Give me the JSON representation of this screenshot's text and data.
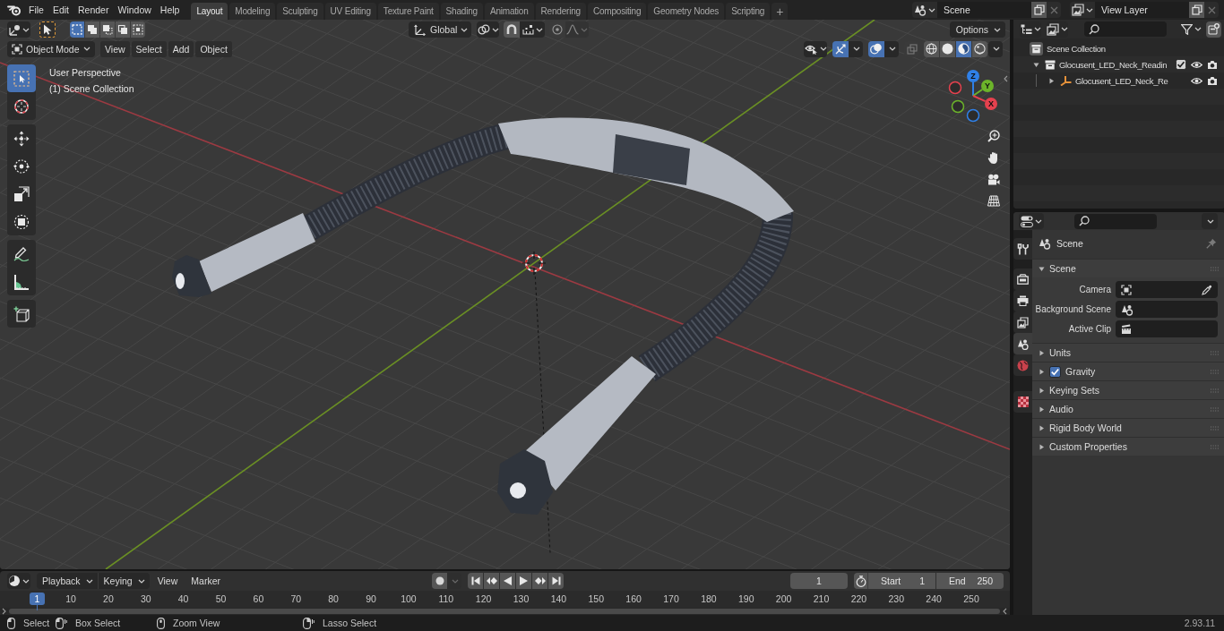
{
  "top_bar": {
    "menus": [
      "File",
      "Edit",
      "Render",
      "Window",
      "Help"
    ],
    "workspaces": [
      {
        "label": "Layout",
        "selected": true
      },
      {
        "label": "Modeling",
        "selected": false
      },
      {
        "label": "Sculpting",
        "selected": false
      },
      {
        "label": "UV Editing",
        "selected": false
      },
      {
        "label": "Texture Paint",
        "selected": false
      },
      {
        "label": "Shading",
        "selected": false
      },
      {
        "label": "Animation",
        "selected": false
      },
      {
        "label": "Rendering",
        "selected": false
      },
      {
        "label": "Compositing",
        "selected": false
      },
      {
        "label": "Geometry Nodes",
        "selected": false
      },
      {
        "label": "Scripting",
        "selected": false
      }
    ],
    "add_workspace": "+",
    "scene": "Scene",
    "view_layer": "View Layer"
  },
  "viewport": {
    "tool_header": {
      "select_modes": [
        {
          "selected": true
        },
        {
          "selected": false
        },
        {
          "selected": false
        },
        {
          "selected": false
        },
        {
          "selected": false
        }
      ],
      "orientation": "Global",
      "snap": {
        "on": false
      },
      "proportional": {
        "on": false
      },
      "options": "Options"
    },
    "header": {
      "mode": "Object Mode",
      "menus": [
        "View",
        "Select",
        "Add",
        "Object"
      ],
      "gizmos": {
        "on": true
      },
      "overlays": {
        "on": true
      },
      "xray": {
        "on": false
      },
      "shading": [
        {
          "selected": false
        },
        {
          "selected": false
        },
        {
          "selected": true
        },
        {
          "selected": false
        }
      ]
    },
    "tools": [
      {
        "selected": true
      },
      {
        "selected": false
      },
      {
        "selected": false
      },
      {
        "selected": false
      },
      {
        "selected": false
      },
      {
        "selected": false
      },
      {
        "selected": false
      },
      {
        "selected": false
      },
      {
        "selected": false
      }
    ],
    "info": [
      "User Perspective",
      "(1) Scene Collection"
    ],
    "navigation_gizmo": [
      {
        "label": "Z",
        "color": "#2f80e8"
      },
      {
        "label": "Y",
        "color": "#6cb42a"
      },
      {
        "label": "X",
        "color": "#e5414e"
      }
    ]
  },
  "outliner": {
    "tree": [
      {
        "kind": "scene_collection",
        "label": "Scene Collection",
        "children": [
          {
            "kind": "collection",
            "label": "Glocusent_LED_Neck_Readin",
            "expanded": true,
            "checked": true,
            "children": [
              {
                "kind": "object",
                "label": "Glocusent_LED_Neck_Re",
                "expanded": false
              }
            ]
          }
        ]
      }
    ]
  },
  "properties": {
    "tabs": [
      {
        "selected": false
      },
      {
        "selected": false
      },
      {
        "selected": false
      },
      {
        "selected": false
      },
      {
        "selected": true
      },
      {
        "selected": false
      },
      {
        "selected": false
      }
    ],
    "context": "Scene",
    "panels": [
      {
        "title": "Scene",
        "kind": "plain",
        "expanded": true,
        "fields": [
          {
            "label": "Camera",
            "kind": "object"
          },
          {
            "label": "Background Scene",
            "kind": "scene"
          },
          {
            "label": "Active Clip",
            "kind": "clip"
          }
        ]
      },
      {
        "title": "Units",
        "kind": "plain",
        "expanded": false
      },
      {
        "title": "Gravity",
        "kind": "toggle",
        "checked": true,
        "expanded": false
      },
      {
        "title": "Keying Sets",
        "kind": "plain",
        "expanded": false
      },
      {
        "title": "Audio",
        "kind": "plain",
        "expanded": false
      },
      {
        "title": "Rigid Body World",
        "kind": "plain",
        "expanded": false
      },
      {
        "title": "Custom Properties",
        "kind": "plain",
        "expanded": false
      }
    ]
  },
  "timeline": {
    "menus": [
      {
        "label": "Playback",
        "kind": "dropdown"
      },
      {
        "label": "Keying",
        "kind": "dropdown"
      },
      {
        "label": "View",
        "kind": "menu"
      },
      {
        "label": "Marker",
        "kind": "menu"
      }
    ],
    "auto_keying": {
      "on": false
    },
    "current_frame": "1",
    "start": {
      "label": "Start",
      "value": "1"
    },
    "end": {
      "label": "End",
      "value": "250"
    },
    "ruler": {
      "current": "1",
      "labels": [
        "10",
        "20",
        "30",
        "40",
        "50",
        "60",
        "70",
        "80",
        "90",
        "100",
        "110",
        "120",
        "130",
        "140",
        "150",
        "160",
        "170",
        "180",
        "190",
        "200",
        "210",
        "220",
        "230",
        "240",
        "250"
      ]
    }
  },
  "status_bar": {
    "hints": [
      {
        "label": "Select",
        "kind": "left_click"
      },
      {
        "label": "Box Select",
        "kind": "left_drag"
      },
      {
        "label": "Zoom View",
        "kind": "middle_click"
      },
      {
        "label": "Lasso Select",
        "kind": "right_drag"
      }
    ],
    "version": "2.93.11"
  }
}
